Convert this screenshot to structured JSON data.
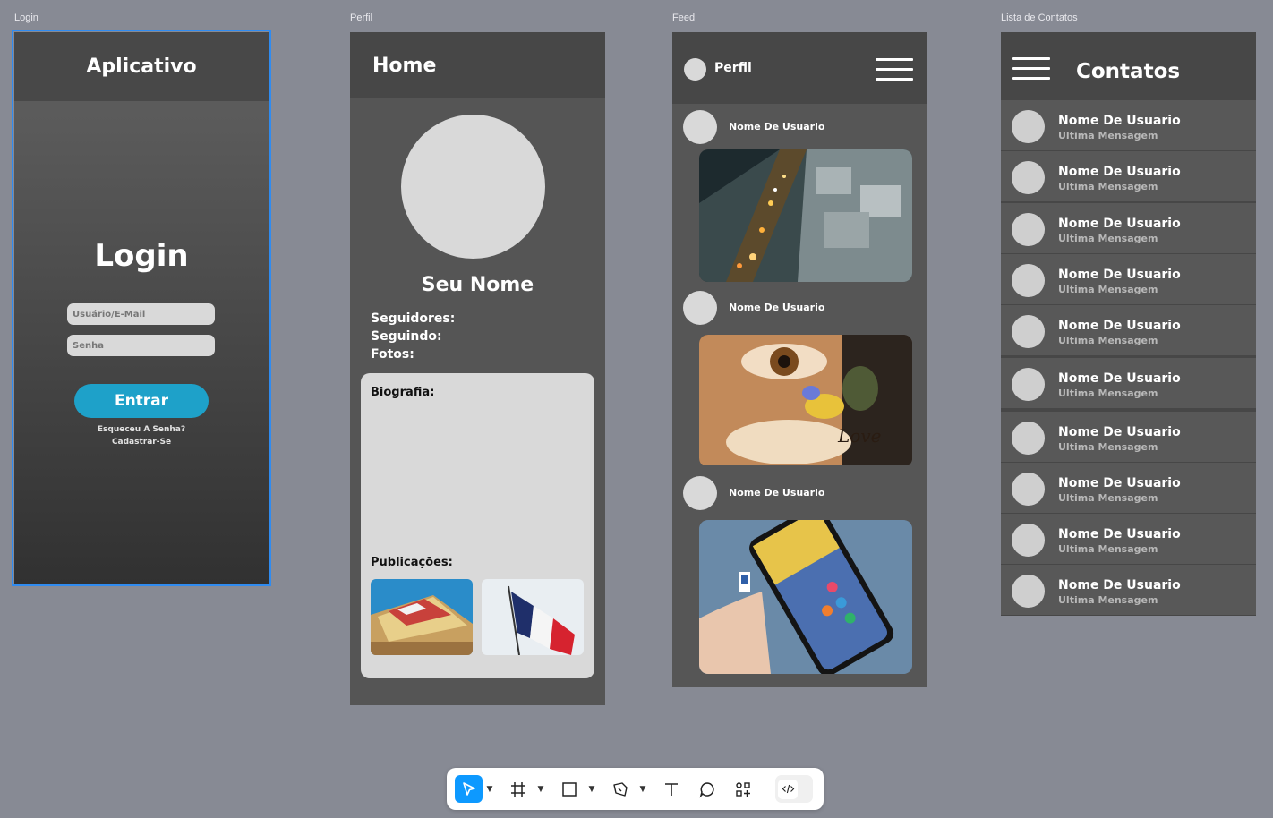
{
  "frames": {
    "login_label": "Login",
    "perfil_label": "Perfil",
    "feed_label": "Feed",
    "contatos_label": "Lista de Contatos"
  },
  "login": {
    "app_title": "Aplicativo",
    "title": "Login",
    "user_placeholder": "Usuário/E-Mail",
    "password_placeholder": "Senha",
    "enter_label": "Entrar",
    "forgot_label": "Esqueceu A Senha?",
    "register_label": "Cadastrar-Se"
  },
  "perfil": {
    "header": "Home",
    "name": "Seu Nome",
    "followers_label": "Seguidores:",
    "following_label": "Seguindo:",
    "photos_label": "Fotos:",
    "bio_label": "Biografia:",
    "posts_label": "Publicações:"
  },
  "feed": {
    "header": "Perfil",
    "posts": [
      {
        "user": "Nome De Usuario"
      },
      {
        "user": "Nome De Usuario"
      },
      {
        "user": "Nome De Usuario"
      }
    ]
  },
  "contatos": {
    "header": "Contatos",
    "items": [
      {
        "name": "Nome De Usuario",
        "message": "Ultima Mensagem"
      },
      {
        "name": "Nome De Usuario",
        "message": "Ultima Mensagem"
      },
      {
        "name": "Nome De Usuario",
        "message": "Ultima Mensagem"
      },
      {
        "name": "Nome De Usuario",
        "message": "Ultima Mensagem"
      },
      {
        "name": "Nome De Usuario",
        "message": "Ultima Mensagem"
      },
      {
        "name": "Nome De Usuario",
        "message": "Ultima Mensagem"
      },
      {
        "name": "Nome De Usuario",
        "message": "Ultima Mensagem"
      },
      {
        "name": "Nome De Usuario",
        "message": "Ultima Mensagem"
      },
      {
        "name": "Nome De Usuario",
        "message": "Ultima Mensagem"
      },
      {
        "name": "Nome De Usuario",
        "message": "Ultima Mensagem"
      }
    ]
  },
  "toolbar": {
    "tools": [
      "move-tool",
      "frame-tool",
      "shape-tool",
      "pen-tool",
      "text-tool",
      "comment-tool",
      "components-tool",
      "dev-mode-toggle"
    ],
    "active_tool": "move-tool",
    "accent_color": "#0d99ff"
  },
  "colors": {
    "canvas": "#878a94",
    "selection": "#2f8bf0",
    "button": "#1ea1c9"
  }
}
